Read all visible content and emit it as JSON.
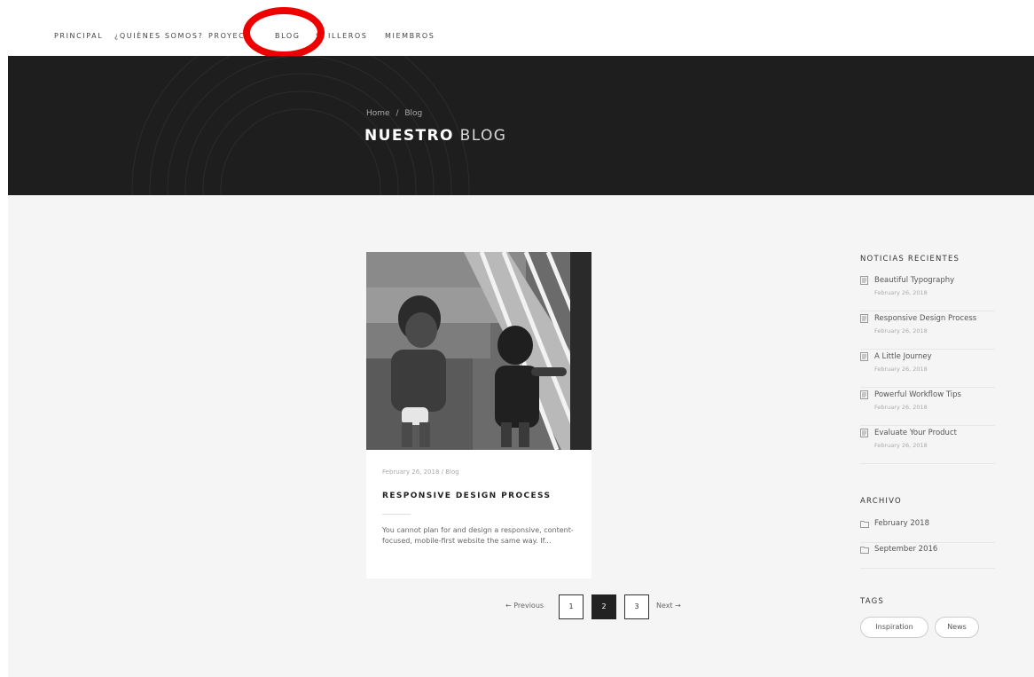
{
  "nav": {
    "items": [
      "PRINCIPAL",
      "¿QUIÈNES SOMOS?",
      "PROYECT",
      "BLOG",
      "S",
      "ILLEROS",
      "MIEMBROS"
    ]
  },
  "hero": {
    "breadcrumb": [
      "Home",
      "/",
      "Blog"
    ],
    "title_bold": "NUESTRO",
    "title_light": "BLOG"
  },
  "post": {
    "date": "February 26, 2018",
    "separator": "/",
    "category": "Blog",
    "title": "RESPONSIVE DESIGN PROCESS",
    "excerpt": "You cannot plan for and design a responsive, content-focused, mobile-first website the same way. If..."
  },
  "pagination": {
    "previous": "← Previous",
    "pages": [
      "1",
      "2",
      "3"
    ],
    "active_page": "2",
    "next": "Next →"
  },
  "sidebar": {
    "recent_title": "NOTICIAS RECIENTES",
    "recent": [
      {
        "title": "Beautiful Typography",
        "date": "February 26, 2018"
      },
      {
        "title": "Responsive Design Process",
        "date": "February 26, 2018"
      },
      {
        "title": "A Little Journey",
        "date": "February 26, 2018"
      },
      {
        "title": "Powerful Workflow Tips",
        "date": "February 26, 2018"
      },
      {
        "title": "Evaluate Your Product",
        "date": "February 26, 2018"
      }
    ],
    "archive_title": "ARCHIVO",
    "archive": [
      "February 2018",
      "September 2016"
    ],
    "tags_title": "TAGS",
    "tags": [
      "Inspiration",
      "News"
    ]
  },
  "colors": {
    "annotation_ring": "#ee0000",
    "hero_background": "#1e1e1e",
    "content_background": "#f5f5f5",
    "active_page": "#222222"
  },
  "icons": {
    "recent_post": "document-icon",
    "archive": "folder-icon"
  }
}
